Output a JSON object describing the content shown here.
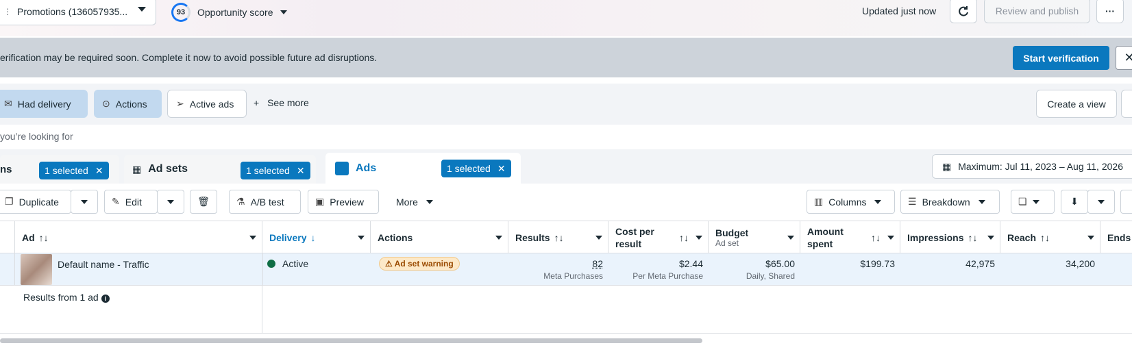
{
  "topbar": {
    "campaign_dropdown": "Promotions (136057935...",
    "opportunity_score_value": "93",
    "opportunity_score_label": "Opportunity score",
    "updated_text": "Updated just now",
    "review_publish_label": "Review and publish"
  },
  "banner": {
    "text": "erification may be required soon. Complete it now to avoid possible future ad disruptions.",
    "start_label": "Start verification"
  },
  "filters": {
    "had_delivery": "Had delivery",
    "actions": "Actions",
    "active_ads": "Active ads",
    "see_more": "See more",
    "create_view": "Create a view"
  },
  "search": {
    "placeholder": "you’re looking for"
  },
  "tabs": {
    "campaigns_partial": "ns",
    "campaigns_selected": "1 selected",
    "adsets": "Ad sets",
    "adsets_selected": "1 selected",
    "ads": "Ads",
    "ads_selected": "1 selected",
    "date_range": "Maximum: Jul 11, 2023 – Aug 11, 2026"
  },
  "toolbar": {
    "duplicate": "Duplicate",
    "edit": "Edit",
    "ab_test": "A/B test",
    "preview": "Preview",
    "more": "More",
    "columns": "Columns",
    "breakdown": "Breakdown"
  },
  "table": {
    "headers": {
      "ad": "Ad",
      "delivery": "Delivery",
      "actions": "Actions",
      "results": "Results",
      "cost_per_result": "Cost per result",
      "budget": "Budget",
      "budget_sub": "Ad set",
      "amount_spent": "Amount spent",
      "impressions": "Impressions",
      "reach": "Reach",
      "ends": "Ends"
    },
    "row": {
      "name": "Default name - Traffic",
      "delivery": "Active",
      "actions": "Ad set warning",
      "results": "82",
      "results_sub": "Meta Purchases",
      "cost": "$2.44",
      "cost_sub": "Per Meta Purchase",
      "budget": "$65.00",
      "budget_sub": "Daily, Shared",
      "amount_spent": "$199.73",
      "impressions": "42,975",
      "reach": "34,200"
    },
    "summary": "Results from 1 ad"
  },
  "colors": {
    "primary": "#0a78be",
    "active_dot": "#0f6e45",
    "warning_bg": "#fde9c8"
  }
}
